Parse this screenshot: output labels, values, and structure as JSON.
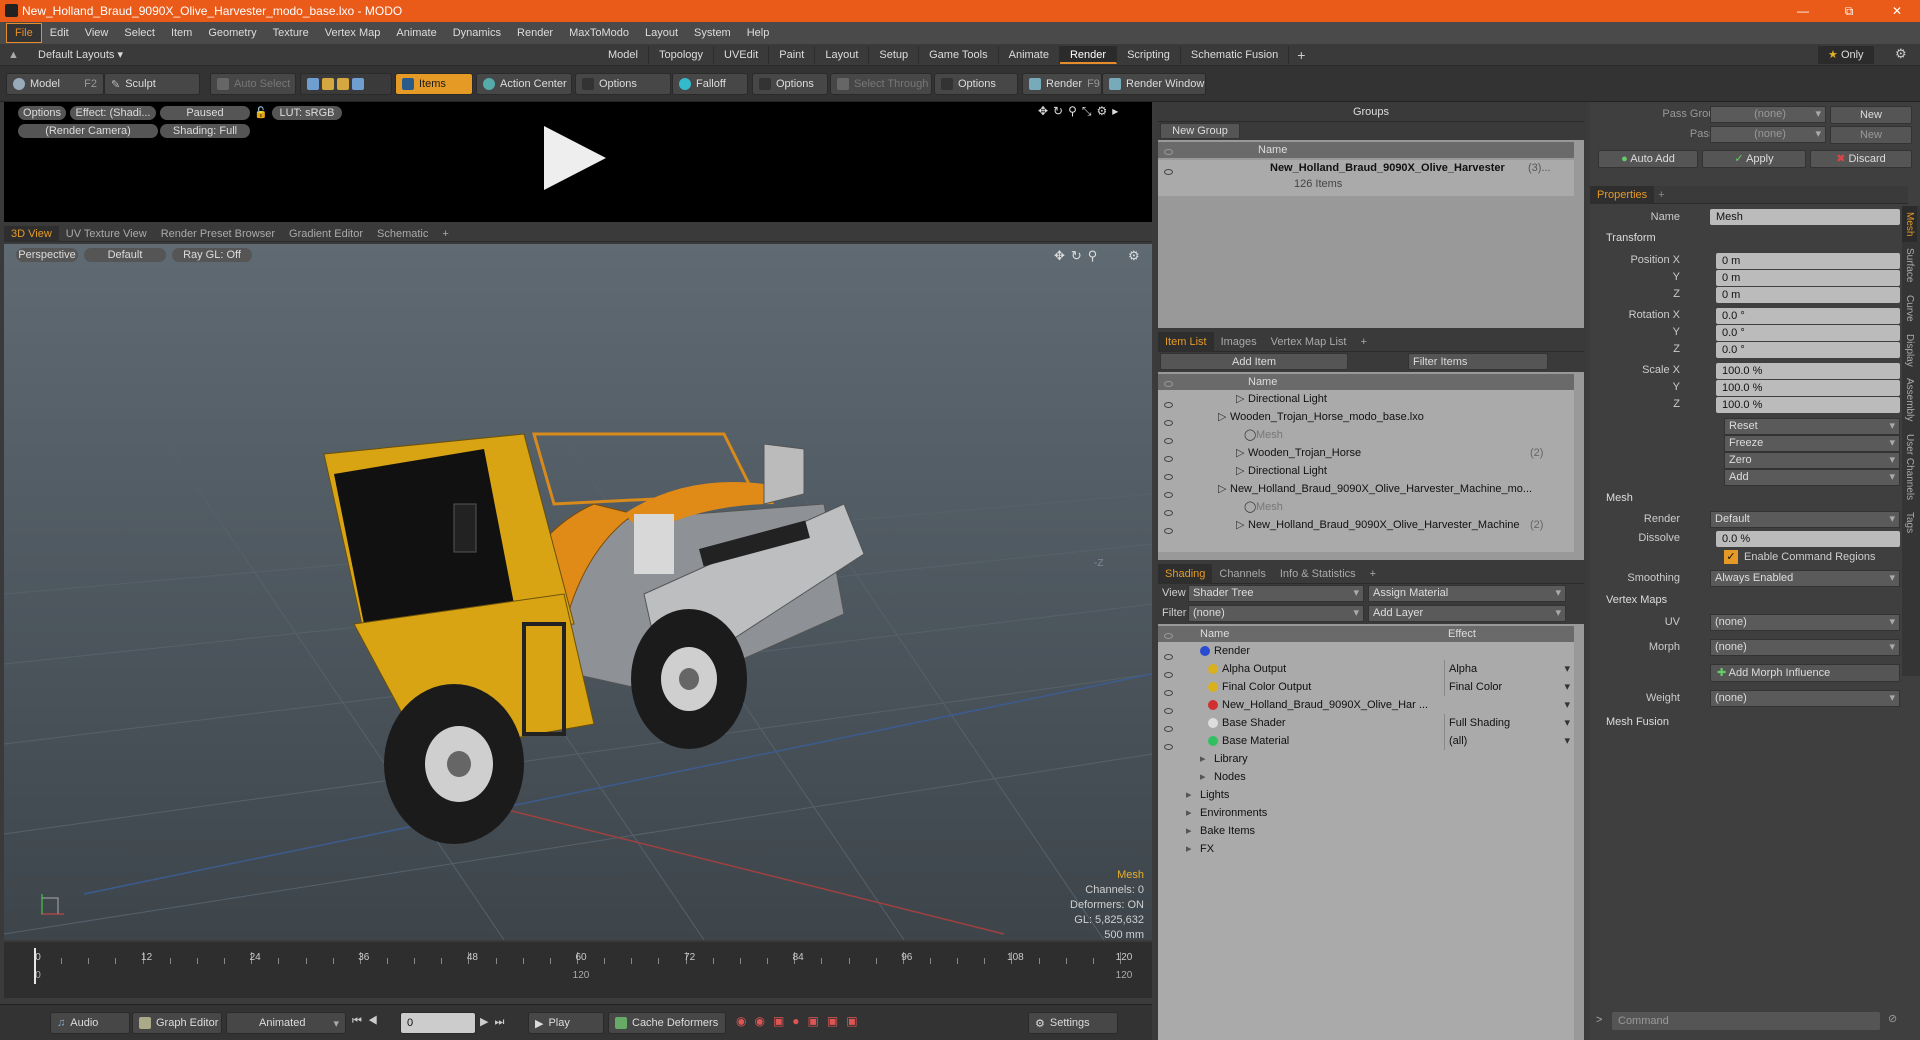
{
  "window": {
    "title": "New_Holland_Braud_9090X_Olive_Harvester_modo_base.lxo - MODO"
  },
  "menu": [
    "File",
    "Edit",
    "View",
    "Select",
    "Item",
    "Geometry",
    "Texture",
    "Vertex Map",
    "Animate",
    "Dynamics",
    "Render",
    "MaxToModo",
    "Layout",
    "System",
    "Help"
  ],
  "layouts": {
    "default": "Default Layouts ▾",
    "tabs": [
      "Model",
      "Topology",
      "UVEdit",
      "Paint",
      "Layout",
      "Setup",
      "Game Tools",
      "Animate",
      "Render",
      "Scripting",
      "Schematic Fusion"
    ],
    "plus": "+",
    "only": "Only"
  },
  "toolbar": {
    "model": "Model",
    "model_key": "F2",
    "sculpt": "Sculpt",
    "auto_select": "Auto Select",
    "items": "Items",
    "action_center": "Action Center",
    "options1": "Options",
    "falloff": "Falloff",
    "options2": "Options",
    "select_through": "Select Through",
    "options3": "Options",
    "render": "Render",
    "render_key": "F9",
    "render_window": "Render Window"
  },
  "render_view": {
    "options": "Options",
    "effect": "Effect: (Shadi...",
    "paused": "Paused",
    "lut": "LUT: sRGB",
    "camera": "(Render Camera)",
    "shading": "Shading: Full"
  },
  "view_tabs": [
    "3D View",
    "UV Texture View",
    "Render Preset Browser",
    "Gradient Editor",
    "Schematic",
    "+"
  ],
  "viewport": {
    "perspective": "Perspective",
    "default": "Default",
    "raygl": "Ray GL: Off",
    "info_title": "Mesh",
    "channels": "Channels: 0",
    "deformers": "Deformers: ON",
    "gl": "GL: 5,825,632",
    "scale": "500 mm",
    "axis_label": "-Z"
  },
  "timeline": {
    "ticks": [
      "0",
      "12",
      "24",
      "36",
      "48",
      "60",
      "72",
      "84",
      "96",
      "108",
      "120"
    ],
    "low": [
      "0",
      "",
      "",
      "",
      "",
      "120",
      "",
      "",
      "",
      "",
      "120"
    ]
  },
  "bottombar": {
    "audio": "Audio",
    "graph_editor": "Graph Editor",
    "animated": "Animated",
    "frame": "0",
    "play": "Play",
    "cache": "Cache Deformers",
    "settings": "Settings"
  },
  "groups": {
    "title": "Groups",
    "new_group": "New Group",
    "col_name": "Name",
    "item": "New_Holland_Braud_9090X_Olive_Harvester",
    "item_count": "(3)...",
    "sub": "126 Items"
  },
  "item_list": {
    "tabs": [
      "Item List",
      "Images",
      "Vertex Map List",
      "+"
    ],
    "add_item": "Add Item",
    "filter": "Filter Items",
    "col_name": "Name",
    "rows": [
      {
        "t": "Directional Light",
        "i": 90,
        "dim": false
      },
      {
        "t": "Wooden_Trojan_Horse_modo_base.lxo",
        "i": 72,
        "dim": false
      },
      {
        "t": "Mesh",
        "i": 98,
        "dim": true
      },
      {
        "t": "Wooden_Trojan_Horse",
        "c": "(2)",
        "i": 90,
        "dim": false
      },
      {
        "t": "Directional Light",
        "i": 90,
        "dim": false
      },
      {
        "t": "New_Holland_Braud_9090X_Olive_Harvester_Machine_mo...",
        "i": 72,
        "dim": false
      },
      {
        "t": "Mesh",
        "i": 98,
        "dim": true
      },
      {
        "t": "New_Holland_Braud_9090X_Olive_Harvester_Machine",
        "c": "(2)",
        "i": 90,
        "dim": false
      }
    ]
  },
  "shading": {
    "tabs": [
      "Shading",
      "Channels",
      "Info & Statistics",
      "+"
    ],
    "view_label": "View",
    "view": "Shader Tree",
    "assign": "Assign Material",
    "filter_label": "Filter",
    "filter": "(none)",
    "add_layer": "Add Layer",
    "col_name": "Name",
    "col_effect": "Effect",
    "rows": [
      {
        "t": "Render",
        "e": "",
        "i": 56
      },
      {
        "t": "Alpha Output",
        "e": "Alpha",
        "i": 64
      },
      {
        "t": "Final Color Output",
        "e": "Final Color",
        "i": 64
      },
      {
        "t": "New_Holland_Braud_9090X_Olive_Har ...",
        "e": "",
        "i": 64
      },
      {
        "t": "Base Shader",
        "e": "Full Shading",
        "i": 64
      },
      {
        "t": "Base Material",
        "e": "(all)",
        "i": 64
      },
      {
        "t": "Library",
        "e": "",
        "i": 56
      },
      {
        "t": "Nodes",
        "e": "",
        "i": 56
      },
      {
        "t": "Lights",
        "e": "",
        "i": 42
      },
      {
        "t": "Environments",
        "e": "",
        "i": 42
      },
      {
        "t": "Bake Items",
        "e": "",
        "i": 42
      },
      {
        "t": "FX",
        "e": "",
        "i": 42
      }
    ]
  },
  "pass": {
    "pass_groups": "Pass Groups",
    "passes": "Passes",
    "none1": "(none)",
    "none2": "(none)",
    "new1": "New",
    "new2": "New",
    "auto_add": "Auto Add",
    "apply": "Apply",
    "discard": "Discard"
  },
  "props": {
    "tab": "Properties",
    "name_label": "Name",
    "name": "Mesh",
    "transform": "Transform",
    "pos": [
      "0 m",
      "0 m",
      "0 m"
    ],
    "rot": [
      "0.0 °",
      "0.0 °",
      "0.0 °"
    ],
    "scl": [
      "100.0 %",
      "100.0 %",
      "100.0 %"
    ],
    "position_x": "Position X",
    "rotation_x": "Rotation X",
    "scale_x": "Scale X",
    "y": "Y",
    "z": "Z",
    "reset": "Reset",
    "freeze": "Freeze",
    "zero": "Zero",
    "add": "Add",
    "mesh": "Mesh",
    "render_label": "Render",
    "render": "Default",
    "dissolve_label": "Dissolve",
    "dissolve": "0.0 %",
    "ecr": "Enable Command Regions",
    "smoothing_label": "Smoothing",
    "smoothing": "Always Enabled",
    "vertex_maps": "Vertex Maps",
    "uv_label": "UV",
    "uv": "(none)",
    "morph_label": "Morph",
    "morph": "(none)",
    "add_morph": "Add Morph Influence",
    "weight_label": "Weight",
    "weight": "(none)",
    "mesh_fusion": "Mesh Fusion",
    "side_tabs": [
      "Mesh",
      "Surface",
      "Curve",
      "Display",
      "Assembly",
      "User Channels",
      "Tags"
    ],
    "command": "Command"
  }
}
